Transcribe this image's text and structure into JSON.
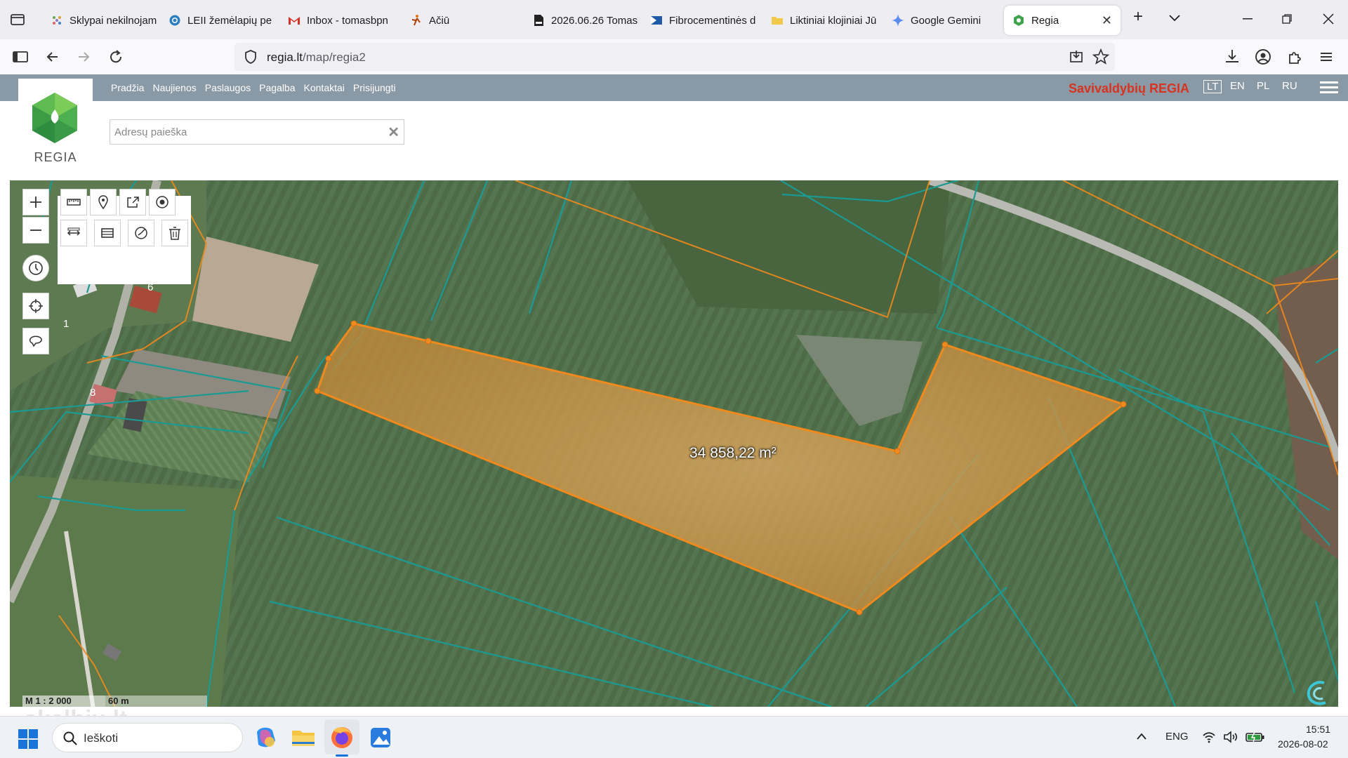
{
  "browser": {
    "tabs": [
      {
        "title": "Sklypai nekilnojam",
        "icon": "grid-dots-icon",
        "active": false
      },
      {
        "title": "LEII žemėlapių pe",
        "icon": "globe-icon",
        "active": false
      },
      {
        "title": "Inbox - tomasbpn",
        "icon": "gmail-icon",
        "active": false
      },
      {
        "title": "Ačiū",
        "icon": "figure-icon",
        "active": false
      },
      {
        "title": "2026.06.26 Tomas",
        "icon": "pdf-icon",
        "active": false
      },
      {
        "title": "Fibrocementinės d",
        "icon": "flag-icon",
        "active": false
      },
      {
        "title": "Liktiniai klojiniai Jū",
        "icon": "folder-icon",
        "active": false
      },
      {
        "title": "Google Gemini",
        "icon": "gemini-icon",
        "active": false
      },
      {
        "title": "Regia",
        "icon": "regia-icon",
        "active": true
      }
    ],
    "url_host": "regia.lt",
    "url_path": "/map/regia2"
  },
  "site": {
    "menu": [
      "Pradžia",
      "Naujienos",
      "Paslaugos",
      "Pagalba",
      "Kontaktai",
      "Prisijungti"
    ],
    "brand_title": "Savivaldybių REGIA",
    "languages": [
      "LT",
      "EN",
      "PL",
      "RU"
    ],
    "selected_language": "LT",
    "logo_text": "REGIA",
    "search_placeholder": "Adresų paieška"
  },
  "map": {
    "area_label": "34 858,22 m²",
    "scale_ratio": "M 1 : 2 000",
    "scale_distance": "60 m",
    "house_numbers": [
      "1",
      "6",
      "8"
    ],
    "colors": {
      "parcel_line": "#1a9a93",
      "highlight": "#f08a1c",
      "highlight_fill": "#d98a2c"
    }
  },
  "taskbar": {
    "search_placeholder": "Ieškoti",
    "language": "ENG",
    "time": "15:51",
    "date": "2026-08-02"
  },
  "watermark": "skelbiu.lt"
}
